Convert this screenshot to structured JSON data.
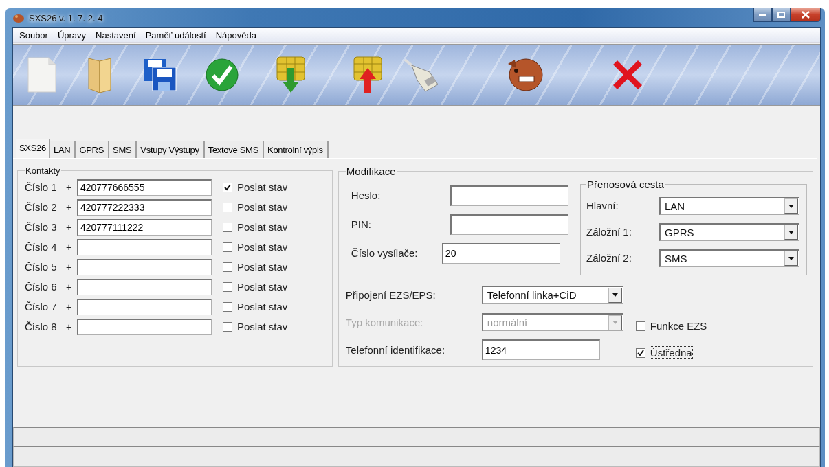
{
  "window": {
    "title": "SXS26 v. 1. 7. 2. 4"
  },
  "menu": [
    "Soubor",
    "Úpravy",
    "Nastavení",
    "Paměť událostí",
    "Nápověda"
  ],
  "toolbar": [
    {
      "kind": "new"
    },
    {
      "kind": "open"
    },
    {
      "kind": "save"
    },
    {
      "kind": "check"
    },
    {
      "kind": "download"
    },
    {
      "kind": "upload"
    },
    {
      "kind": "connector"
    },
    {
      "kind": "dog"
    },
    {
      "kind": "close"
    }
  ],
  "tabs": [
    {
      "label": "SXS26",
      "selected": true
    },
    {
      "label": "LAN",
      "selected": false
    },
    {
      "label": "GPRS",
      "selected": false
    },
    {
      "label": "SMS",
      "selected": false
    },
    {
      "label": "Vstupy Výstupy",
      "selected": false
    },
    {
      "label": "Textove SMS",
      "selected": false
    },
    {
      "label": "Kontrolní výpis",
      "selected": false
    }
  ],
  "contacts": {
    "title": "Kontakty",
    "rows": [
      {
        "label": "Číslo 1",
        "prefix": "+",
        "value": "420777666555",
        "check_label": "Poslat stav",
        "checked": true
      },
      {
        "label": "Číslo 2",
        "prefix": "+",
        "value": "420777222333",
        "check_label": "Poslat stav",
        "checked": false
      },
      {
        "label": "Číslo 3",
        "prefix": "+",
        "value": "420777111222",
        "check_label": "Poslat stav",
        "checked": false
      },
      {
        "label": "Číslo 4",
        "prefix": "+",
        "check_label": "Poslat stav",
        "checked": false
      },
      {
        "label": "Číslo 5",
        "prefix": "+",
        "check_label": "Poslat stav",
        "checked": false
      },
      {
        "label": "Číslo 6",
        "prefix": "+",
        "check_label": "Poslat stav",
        "checked": false
      },
      {
        "label": "Číslo 7",
        "prefix": "+",
        "check_label": "Poslat stav",
        "checked": false
      },
      {
        "label": "Číslo 8",
        "prefix": "+",
        "check_label": "Poslat stav",
        "checked": false
      }
    ]
  },
  "modifikace": {
    "title": "Modifikace",
    "fields": [
      {
        "label": "Heslo:"
      },
      {
        "label": "PIN:"
      },
      {
        "label": "Číslo vysílače:",
        "value": "20"
      }
    ],
    "route": {
      "title": "Přenosová cesta",
      "rows": [
        {
          "label": "Hlavní:",
          "value": "LAN"
        },
        {
          "label": "Záložní 1:",
          "value": "GPRS"
        },
        {
          "label": "Záložní 2:",
          "value": "SMS"
        }
      ]
    },
    "connection": {
      "label": "Připojení EZS/EPS:",
      "value": "Telefonní linka+CiD",
      "disabled": false
    },
    "comm_type": {
      "label": "Typ komunikace:",
      "value": "normální",
      "disabled": true
    },
    "phone_id": {
      "label": "Telefonní identifikace:",
      "value": "1234"
    },
    "checks": [
      {
        "label": "Funkce EZS",
        "checked": false,
        "focused": false
      },
      {
        "label": "Ústředna",
        "checked": true,
        "focused": true
      }
    ]
  }
}
